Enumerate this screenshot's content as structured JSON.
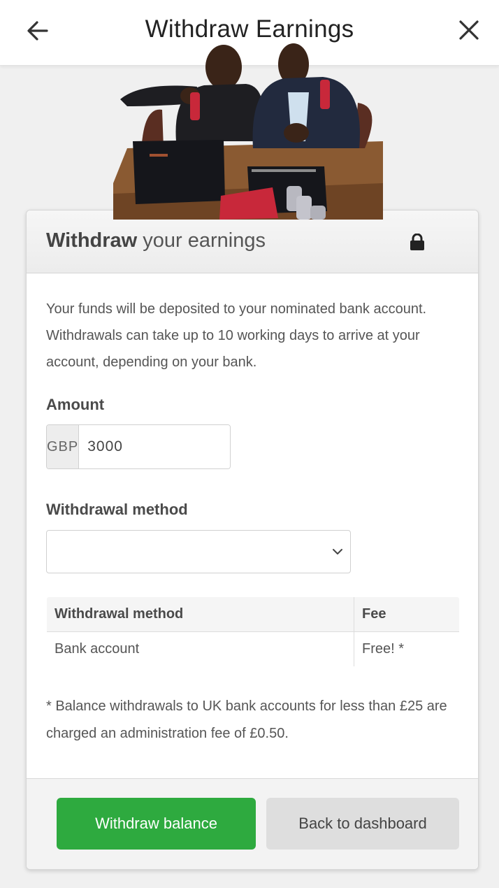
{
  "header": {
    "title": "Withdraw Earnings",
    "back_icon": "arrow-left-icon",
    "close_icon": "close-icon"
  },
  "photo": {
    "description_icon": "photo-image"
  },
  "card": {
    "heading_bold": "Withdraw",
    "heading_rest": "your earnings",
    "lock_icon": "lock-icon",
    "description": "Your funds will be deposited to your nominated bank account. Withdrawals can take up to 10 working days to arrive at your account, depending on your bank.",
    "amount": {
      "label": "Amount",
      "currency": "GBP",
      "value": "3000"
    },
    "method": {
      "label": "Withdrawal method",
      "selected": ""
    },
    "fee_table": {
      "headers": [
        "Withdrawal method",
        "Fee"
      ],
      "rows": [
        [
          "Bank account",
          "Free! *"
        ]
      ]
    },
    "note": "* Balance withdrawals to UK bank accounts for less than £25 are charged an administration fee of £0.50.",
    "buttons": {
      "withdraw": "Withdraw balance",
      "back": "Back to dashboard"
    }
  },
  "colors": {
    "primary_button": "#2eaa3f",
    "secondary_button": "#dedede",
    "background": "#f0f0f0"
  }
}
